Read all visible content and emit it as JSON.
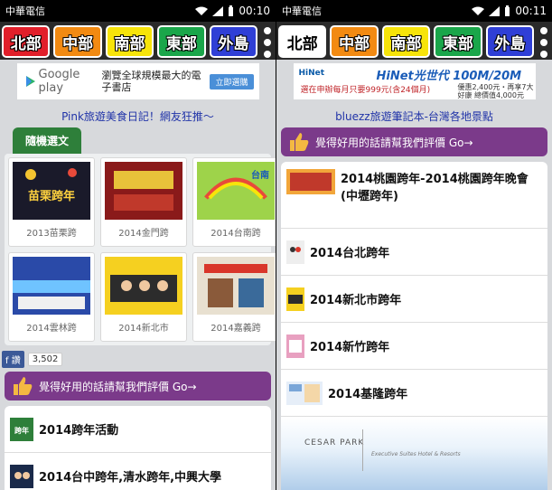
{
  "colors": {
    "statusbar": "#000000",
    "rate_bar": "#7b3a8a",
    "tab_random": "#2e7f3a",
    "link_blue": "#2033a8"
  },
  "left": {
    "status": {
      "carrier": "中華電信",
      "time": "00:10"
    },
    "regions": [
      "北部",
      "中部",
      "南部",
      "東部",
      "外島"
    ],
    "ad": {
      "brand": "Google play",
      "description": "瀏覽全球規模最大的電子書店",
      "button": "立即選購"
    },
    "blog_title": "Pink旅遊美食日記！網友狂推～",
    "tab_random": "隨機選文",
    "grid": [
      {
        "label": "2013苗栗跨",
        "image_text": "苗栗跨年"
      },
      {
        "label": "2014金門跨",
        "image_text": ""
      },
      {
        "label": "2014台南跨",
        "image_text": "台南"
      },
      {
        "label": "2014雲林跨",
        "image_text": ""
      },
      {
        "label": "2014新北市",
        "image_text": ""
      },
      {
        "label": "2014嘉義跨",
        "image_text": ""
      }
    ],
    "fb": {
      "button": "讚",
      "count": "3,502"
    },
    "rate_text": "覺得好用的話請幫我們評價 Go→",
    "list": [
      {
        "text": "2014跨年活動",
        "thumb_text": "跨年"
      },
      {
        "text": "2014台中跨年,清水跨年,中興大學"
      }
    ]
  },
  "right": {
    "status": {
      "carrier": "中華電信",
      "time": "00:11"
    },
    "regions": [
      "北部",
      "中部",
      "南部",
      "東部",
      "外島"
    ],
    "ad": {
      "brand": "HiNet",
      "title": "HiNet光世代 100M/20M",
      "line1": "選在申辦每月只要999元(含24個月)",
      "line2": "優惠2,400元・再享7大好康 總價值4,000元"
    },
    "blog_title": "bluezz旅遊筆記本-台灣各地景點",
    "rate_text": "覺得好用的話請幫我們評價 Go→",
    "list": [
      {
        "text": "2014桃園跨年-2014桃園跨年晚會(中壢跨年)"
      },
      {
        "text": "2014台北跨年"
      },
      {
        "text": "2014新北市跨年"
      },
      {
        "text": "2014新竹跨年"
      },
      {
        "text": "2014基隆跨年"
      }
    ],
    "banner": {
      "brand": "CESAR PARK",
      "subtitle": "Executive Suites Hotel & Resorts"
    }
  }
}
